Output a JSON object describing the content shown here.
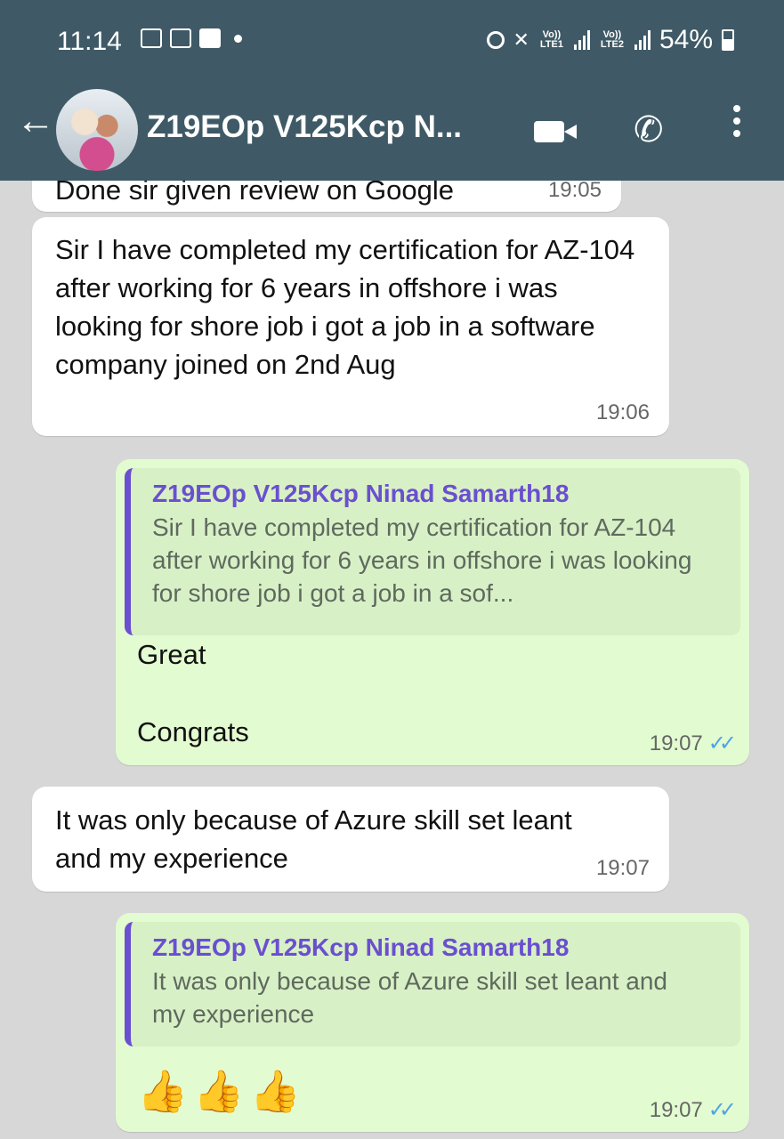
{
  "status_bar": {
    "time": "11:14",
    "lte1": "Vo)) LTE1",
    "lte2": "Vo)) LTE2",
    "battery": "54%"
  },
  "header": {
    "back_icon": "arrow-left-icon",
    "contact_name": "Z19EOp V125Kcp N..."
  },
  "messages": [
    {
      "type": "in",
      "text": "Done sir given review on Google",
      "time": "19:05"
    },
    {
      "type": "in",
      "text": "Sir I have completed my certification for AZ-104 after working for 6 years in offshore i was looking for shore job i got a job in a software company joined on 2nd Aug",
      "time": "19:06"
    },
    {
      "type": "out",
      "quote_name": "Z19EOp V125Kcp Ninad Samarth18",
      "quote_text": "Sir I have completed my certification for AZ-104 after working for 6 years in offshore i was looking for shore job i got a job in a sof...",
      "line1": "Great",
      "line2": "Congrats",
      "time": "19:07",
      "ticks": "✓✓"
    },
    {
      "type": "in",
      "text": "It was only because of Azure skill set leant and my experience",
      "time": "19:07"
    },
    {
      "type": "out",
      "quote_name": "Z19EOp V125Kcp Ninad Samarth18",
      "quote_text": "It was only because of Azure skill set leant and my experience",
      "emoji": "👍👍👍",
      "time": "19:07",
      "ticks": "✓✓"
    }
  ]
}
